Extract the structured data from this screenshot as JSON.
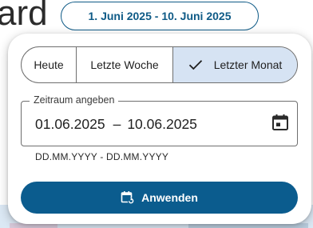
{
  "background": {
    "title_fragment": "ard",
    "date_range_chip": "1. Juni 2025 - 10. Juni 2025"
  },
  "popover": {
    "presets": [
      {
        "label": "Heute",
        "selected": false
      },
      {
        "label": "Letzte Woche",
        "selected": false
      },
      {
        "label": "Letzter Monat",
        "selected": true
      }
    ],
    "range_field": {
      "label": "Zeitraum angeben",
      "start": "01.06.2025",
      "separator": "–",
      "end": "10.06.2025",
      "hint": "DD.MM.YYYY - DD.MM.YYYY",
      "icon": "calendar-icon"
    },
    "apply_button": {
      "label": "Anwenden",
      "icon": "calendar-refresh-icon"
    }
  },
  "colors": {
    "primary": "#0b5c8e",
    "selected_segment": "#d6e3f3",
    "outline": "#6f6f6f",
    "background_strip": "#dbe8f4"
  }
}
